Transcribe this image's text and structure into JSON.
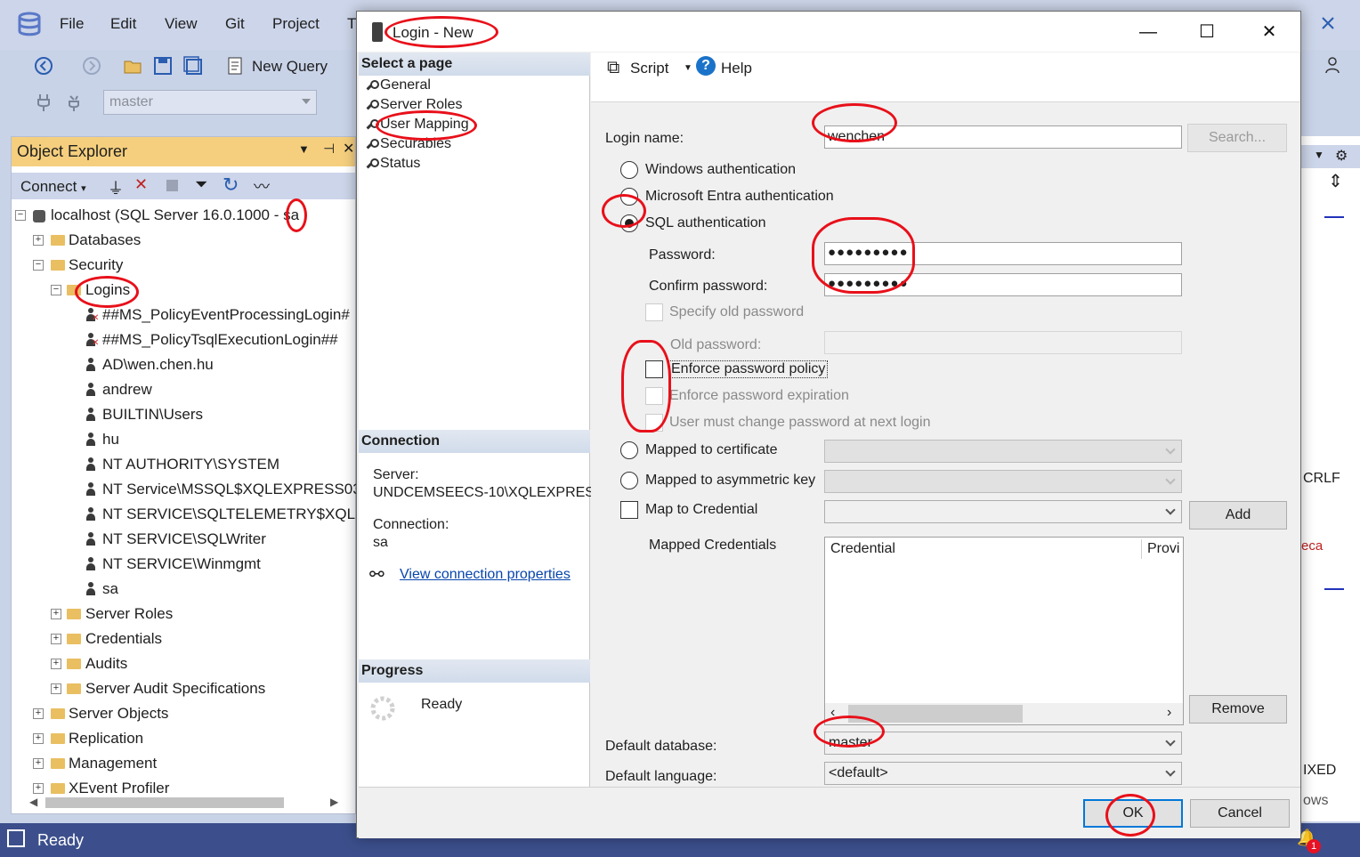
{
  "menu": {
    "file": "File",
    "edit": "Edit",
    "view": "View",
    "git": "Git",
    "project": "Project",
    "tools_partial": "T"
  },
  "toolbar": {
    "new_query": "New Query",
    "database_combo": "master"
  },
  "object_explorer": {
    "title": "Object Explorer",
    "connect": "Connect",
    "server": "localhost (SQL Server 16.0.1000 - sa",
    "databases": "Databases",
    "security": "Security",
    "logins": "Logins",
    "login_items": [
      "##MS_PolicyEventProcessingLogin#",
      "##MS_PolicyTsqlExecutionLogin##",
      "AD\\wen.chen.hu",
      "andrew",
      "BUILTIN\\Users",
      "hu",
      "NT AUTHORITY\\SYSTEM",
      "NT Service\\MSSQL$XQLEXPRESS03",
      "NT SERVICE\\SQLTELEMETRY$XQLE",
      "NT SERVICE\\SQLWriter",
      "NT SERVICE\\Winmgmt",
      "sa"
    ],
    "security_children": [
      "Server Roles",
      "Credentials",
      "Audits",
      "Server Audit Specifications"
    ],
    "top_level": [
      "Server Objects",
      "Replication",
      "Management",
      "XEvent Profiler"
    ]
  },
  "status_bar": {
    "text": "Ready",
    "notification_count": "1"
  },
  "right_strip": {
    "crlf": "CRLF",
    "ixed": "IXED",
    "ows": "ows",
    "eca": "eca"
  },
  "dialog": {
    "title": "Login - New",
    "select_page_header": "Select a page",
    "pages": [
      "General",
      "Server Roles",
      "User Mapping",
      "Securables",
      "Status"
    ],
    "connection_header": "Connection",
    "server_label": "Server:",
    "server_value": "UNDCEMSEECS-10\\XQLEXPRES",
    "connection_label": "Connection:",
    "connection_value": "sa",
    "view_connection_properties": "View connection properties",
    "progress_header": "Progress",
    "progress_status": "Ready",
    "script": "Script",
    "help": "Help",
    "login_name_label": "Login name:",
    "login_name_value": "wenchen",
    "search_button": "Search...",
    "windows_auth": "Windows authentication",
    "entra_auth": "Microsoft Entra authentication",
    "sql_auth": "SQL authentication",
    "password_label": "Password:",
    "password_value": "●●●●●●●●●",
    "confirm_password_label": "Confirm password:",
    "confirm_password_value": "●●●●●●●●●",
    "specify_old_password": "Specify old password",
    "old_password_label": "Old password:",
    "enforce_policy": "Enforce password policy",
    "enforce_expiration": "Enforce password expiration",
    "must_change": "User must change password at next login",
    "mapped_certificate": "Mapped to certificate",
    "mapped_asym_key": "Mapped to asymmetric key",
    "map_credential": "Map to Credential",
    "add_button": "Add",
    "mapped_credentials_label": "Mapped Credentials",
    "grid_columns": [
      "Credential",
      "Provi"
    ],
    "remove_button": "Remove",
    "default_database_label": "Default database:",
    "default_database_value": "master",
    "default_language_label": "Default language:",
    "default_language_value": "<default>",
    "ok_button": "OK",
    "cancel_button": "Cancel"
  },
  "colors": {
    "title_accent": "#f5cf7e",
    "status_bar": "#3c4f8c",
    "annotation": "#e8101a",
    "link": "#0645ad"
  }
}
